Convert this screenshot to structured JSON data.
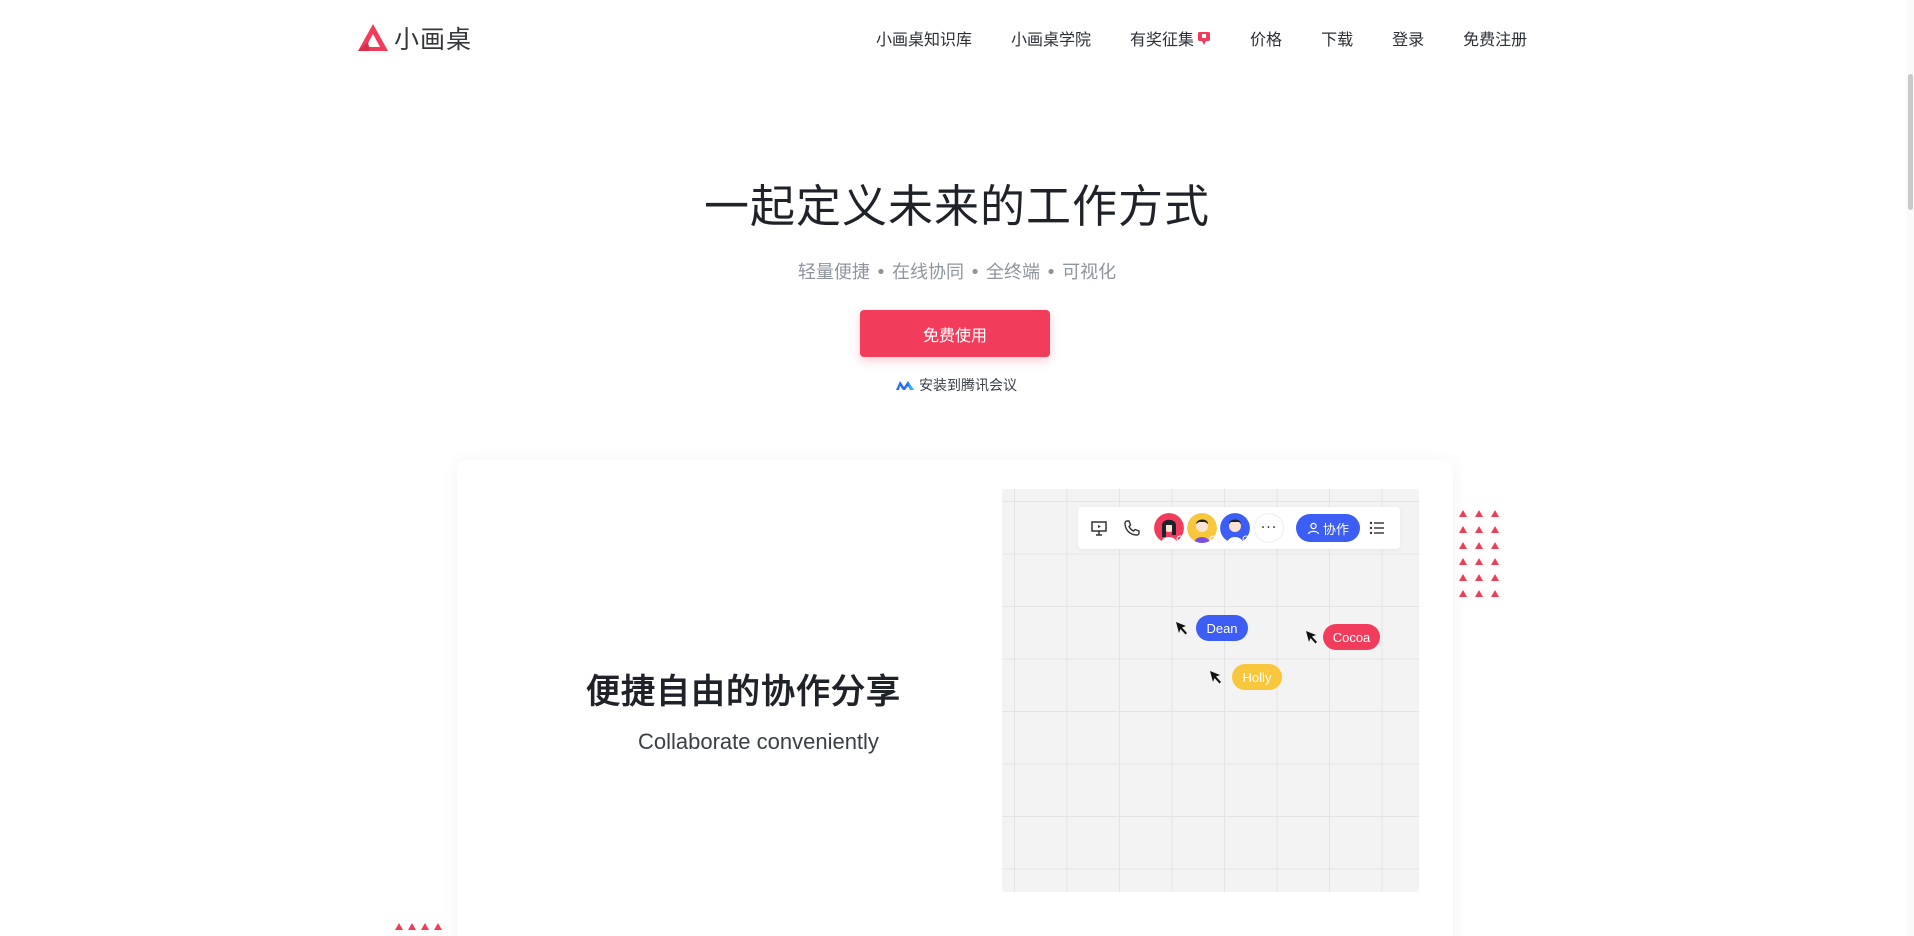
{
  "header": {
    "logo_text": "小画桌",
    "nav": [
      {
        "label": "小画桌知识库"
      },
      {
        "label": "小画桌学院"
      },
      {
        "label": "有奖征集"
      },
      {
        "label": "价格"
      },
      {
        "label": "下载"
      },
      {
        "label": "登录"
      },
      {
        "label": "免费注册"
      }
    ]
  },
  "hero": {
    "title": "一起定义未来的工作方式",
    "subtitle": "轻量便捷 • 在线协同 • 全终端 • 可视化",
    "cta_label": "免费使用",
    "install_label": "安装到腾讯会议"
  },
  "feature": {
    "title": "便捷自由的协作分享",
    "subtitle": "Collaborate conveniently",
    "toolbar": {
      "collab_label": "协作",
      "more_label": "···"
    },
    "cursors": [
      {
        "name": "Dean",
        "color": "#3d5ef5"
      },
      {
        "name": "Cocoa",
        "color": "#f13d5b"
      },
      {
        "name": "Holly",
        "color": "#f8c73d"
      }
    ]
  },
  "colors": {
    "brand": "#f13d5b",
    "accent_blue": "#3d5ef5"
  }
}
